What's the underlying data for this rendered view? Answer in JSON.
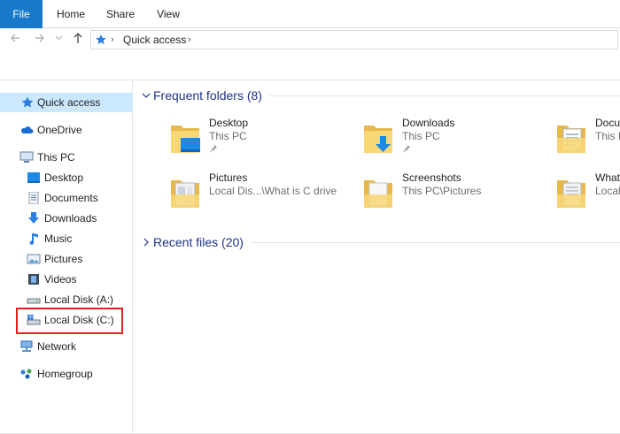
{
  "ribbon": {
    "tabs": [
      {
        "label": "File"
      },
      {
        "label": "Home"
      },
      {
        "label": "Share"
      },
      {
        "label": "View"
      }
    ]
  },
  "address": {
    "path": [
      "Quick access"
    ]
  },
  "sidebar": {
    "items": [
      {
        "label": "Quick access",
        "icon": "star-icon",
        "selected": true
      },
      {
        "label": "OneDrive",
        "icon": "cloud-icon"
      },
      {
        "label": "This PC",
        "icon": "computer-icon"
      },
      {
        "label": "Desktop",
        "icon": "desktop-icon"
      },
      {
        "label": "Documents",
        "icon": "documents-icon"
      },
      {
        "label": "Downloads",
        "icon": "download-arrow-icon"
      },
      {
        "label": "Music",
        "icon": "music-note-icon"
      },
      {
        "label": "Pictures",
        "icon": "pictures-icon"
      },
      {
        "label": "Videos",
        "icon": "film-icon"
      },
      {
        "label": "Local Disk (A:)",
        "icon": "drive-icon"
      },
      {
        "label": "Local Disk (C:)",
        "icon": "windows-drive-icon",
        "highlighted": true
      },
      {
        "label": "Network",
        "icon": "network-icon"
      },
      {
        "label": "Homegroup",
        "icon": "homegroup-icon"
      }
    ]
  },
  "frequent": {
    "header": "Frequent folders (8)",
    "tiles": [
      {
        "name": "Desktop",
        "location": "This PC",
        "pinned": true
      },
      {
        "name": "Downloads",
        "location": "This PC",
        "pinned": true
      },
      {
        "name": "Docu",
        "location": "This P"
      },
      {
        "name": "Pictures",
        "location": "Local Dis...\\What is C drive"
      },
      {
        "name": "Screenshots",
        "location": "This PC\\Pictures"
      },
      {
        "name": "What",
        "location": "Local"
      }
    ]
  },
  "recent": {
    "header": "Recent files (20)"
  },
  "colors": {
    "accent": "#1979ca",
    "selected_bg": "#cce8ff",
    "header_text": "#1e3287",
    "highlight_border": "#e02020",
    "folder_yellow": "#f8d775"
  }
}
